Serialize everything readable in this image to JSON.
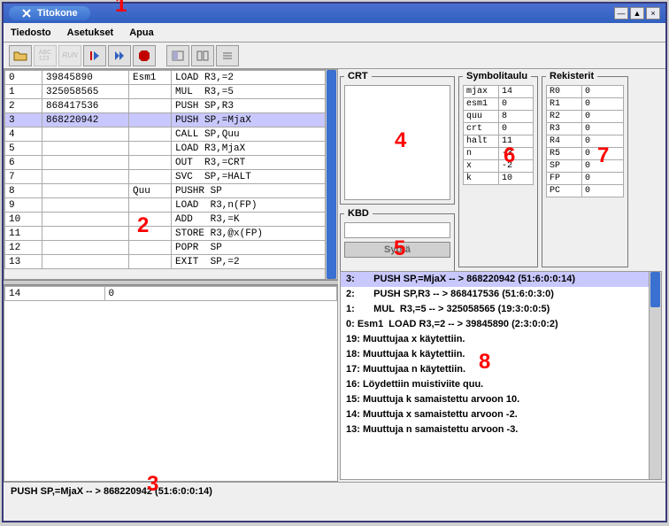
{
  "window": {
    "title": "Titokone"
  },
  "menu": {
    "file": "Tiedosto",
    "settings": "Asetukset",
    "help": "Apua"
  },
  "annotations": {
    "n1": "1",
    "n2": "2",
    "n3": "3",
    "n4": "4",
    "n5": "5",
    "n6": "6",
    "n7": "7",
    "n8": "8"
  },
  "code": {
    "selected": 3,
    "rows": [
      {
        "line": "0",
        "val": "39845890",
        "lbl": "Esm1",
        "instr": "LOAD R3,=2"
      },
      {
        "line": "1",
        "val": "325058565",
        "lbl": "",
        "instr": "MUL  R3,=5"
      },
      {
        "line": "2",
        "val": "868417536",
        "lbl": "",
        "instr": "PUSH SP,R3"
      },
      {
        "line": "3",
        "val": "868220942",
        "lbl": "",
        "instr": "PUSH SP,=MjaX"
      },
      {
        "line": "4",
        "val": "",
        "lbl": "",
        "instr": "CALL SP,Quu"
      },
      {
        "line": "5",
        "val": "",
        "lbl": "",
        "instr": "LOAD R3,MjaX"
      },
      {
        "line": "6",
        "val": "",
        "lbl": "",
        "instr": "OUT  R3,=CRT"
      },
      {
        "line": "7",
        "val": "",
        "lbl": "",
        "instr": "SVC  SP,=HALT"
      },
      {
        "line": "8",
        "val": "",
        "lbl": "Quu",
        "instr": "PUSHR SP"
      },
      {
        "line": "9",
        "val": "",
        "lbl": "",
        "instr": "LOAD  R3,n(FP)"
      },
      {
        "line": "10",
        "val": "",
        "lbl": "",
        "instr": "ADD   R3,=K"
      },
      {
        "line": "11",
        "val": "",
        "lbl": "",
        "instr": "STORE R3,@x(FP)"
      },
      {
        "line": "12",
        "val": "",
        "lbl": "",
        "instr": "POPR  SP"
      },
      {
        "line": "13",
        "val": "",
        "lbl": "",
        "instr": "EXIT  SP,=2"
      }
    ]
  },
  "dataRows": [
    {
      "addr": "14",
      "val": "0"
    }
  ],
  "panels": {
    "crt": {
      "legend": "CRT"
    },
    "kbd": {
      "legend": "KBD",
      "button": "Syötä",
      "value": ""
    },
    "sym": {
      "legend": "Symbolitaulu",
      "rows": [
        {
          "k": "mjax",
          "v": "14"
        },
        {
          "k": "esm1",
          "v": "0"
        },
        {
          "k": "quu",
          "v": "8"
        },
        {
          "k": "crt",
          "v": "0"
        },
        {
          "k": "halt",
          "v": "11"
        },
        {
          "k": "n",
          "v": "-3"
        },
        {
          "k": "x",
          "v": "-2"
        },
        {
          "k": "k",
          "v": "10"
        }
      ]
    },
    "reg": {
      "legend": "Rekisterit",
      "rows": [
        {
          "k": "R0",
          "v": "0"
        },
        {
          "k": "R1",
          "v": "0"
        },
        {
          "k": "R2",
          "v": "0"
        },
        {
          "k": "R3",
          "v": "0"
        },
        {
          "k": "R4",
          "v": "0"
        },
        {
          "k": "R5",
          "v": "0"
        },
        {
          "k": "SP",
          "v": "0"
        },
        {
          "k": "FP",
          "v": "0"
        },
        {
          "k": "PC",
          "v": "0"
        }
      ]
    }
  },
  "log": {
    "selected": 0,
    "lines": [
      "3:       PUSH SP,=MjaX -- > 868220942 (51:6:0:0:14)",
      "2:       PUSH SP,R3 -- > 868417536 (51:6:0:3:0)",
      "1:       MUL  R3,=5 -- > 325058565 (19:3:0:0:5)",
      "0: Esm1  LOAD R3,=2 -- > 39845890 (2:3:0:0:2)",
      "19: Muuttujaa x käytettiin.",
      "18: Muuttujaa k käytettiin.",
      "17: Muuttujaa n käytettiin.",
      "16: Löydettiin muistiviite quu.",
      "15: Muuttuja k samaistettu arvoon 10.",
      "14: Muuttuja x samaistettu arvoon -2.",
      "13: Muuttuja n samaistettu arvoon -3."
    ]
  },
  "status": "PUSH SP,=MjaX -- > 868220942 (51:6:0:0:14)"
}
